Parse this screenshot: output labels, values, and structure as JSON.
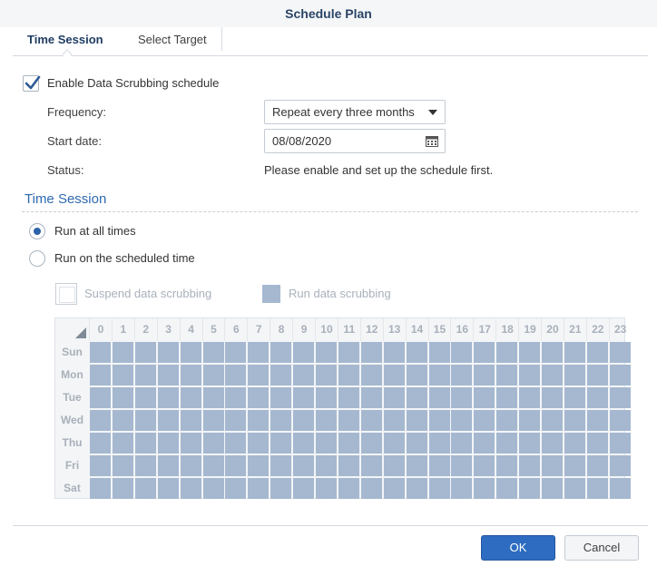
{
  "window": {
    "title": "Schedule Plan"
  },
  "tabs": [
    {
      "label": "Time Session",
      "active": true
    },
    {
      "label": "Select Target",
      "active": false
    }
  ],
  "schedule": {
    "enable_label": "Enable Data Scrubbing schedule",
    "enabled": true,
    "frequency_label": "Frequency:",
    "frequency_value": "Repeat every three months",
    "start_date_label": "Start date:",
    "start_date_value": "08/08/2020",
    "status_label": "Status:",
    "status_value": "Please enable and set up the schedule first."
  },
  "time_session": {
    "title": "Time Session",
    "options": [
      {
        "label": "Run at all times",
        "selected": true
      },
      {
        "label": "Run on the scheduled time",
        "selected": false
      }
    ],
    "legend": {
      "suspend_label": "Suspend data scrubbing",
      "run_label": "Run data scrubbing"
    },
    "hours": [
      "0",
      "1",
      "2",
      "3",
      "4",
      "5",
      "6",
      "7",
      "8",
      "9",
      "10",
      "11",
      "12",
      "13",
      "14",
      "15",
      "16",
      "17",
      "18",
      "19",
      "20",
      "21",
      "22",
      "23"
    ],
    "days": [
      "Sun",
      "Mon",
      "Tue",
      "Wed",
      "Thu",
      "Fri",
      "Sat"
    ]
  },
  "footer": {
    "ok_label": "OK",
    "cancel_label": "Cancel"
  },
  "colors": {
    "run_cell": "#a5b8d0",
    "accent": "#2d6cc0",
    "section_title": "#2e6ab1"
  }
}
